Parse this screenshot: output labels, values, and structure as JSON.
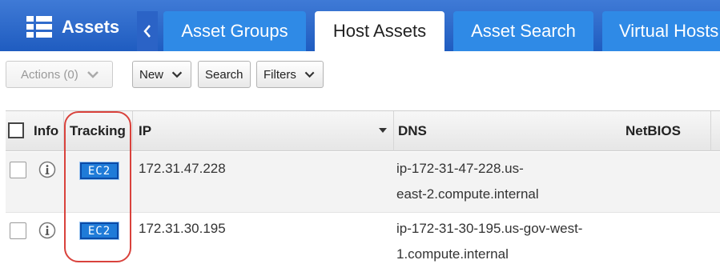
{
  "header": {
    "module_title": "Assets",
    "tabs": [
      {
        "label": "Asset Groups",
        "active": false
      },
      {
        "label": "Host Assets",
        "active": true
      },
      {
        "label": "Asset Search",
        "active": false
      },
      {
        "label": "Virtual Hosts",
        "active": false
      }
    ]
  },
  "toolbar": {
    "actions_label": "Actions (0)",
    "new_label": "New",
    "search_label": "Search",
    "filters_label": "Filters"
  },
  "table": {
    "columns": {
      "info": "Info",
      "tracking": "Tracking",
      "ip": "IP",
      "dns": "DNS",
      "netbios": "NetBIOS"
    },
    "rows": [
      {
        "tracking": "EC2",
        "ip": "172.31.47.228",
        "dns_line1": "ip-172-31-47-228.us-",
        "dns_line2": "east-2.compute.internal",
        "netbios": ""
      },
      {
        "tracking": "EC2",
        "ip": "172.31.30.195",
        "dns_line1": "ip-172-31-30-195.us-gov-west-",
        "dns_line2": "1.compute.internal",
        "netbios": ""
      }
    ]
  },
  "colors": {
    "header_blue": "#1f5cc0",
    "tab_blue": "#2f8ae6",
    "badge_blue": "#1f7bd8",
    "highlight_red": "#d9423c"
  }
}
